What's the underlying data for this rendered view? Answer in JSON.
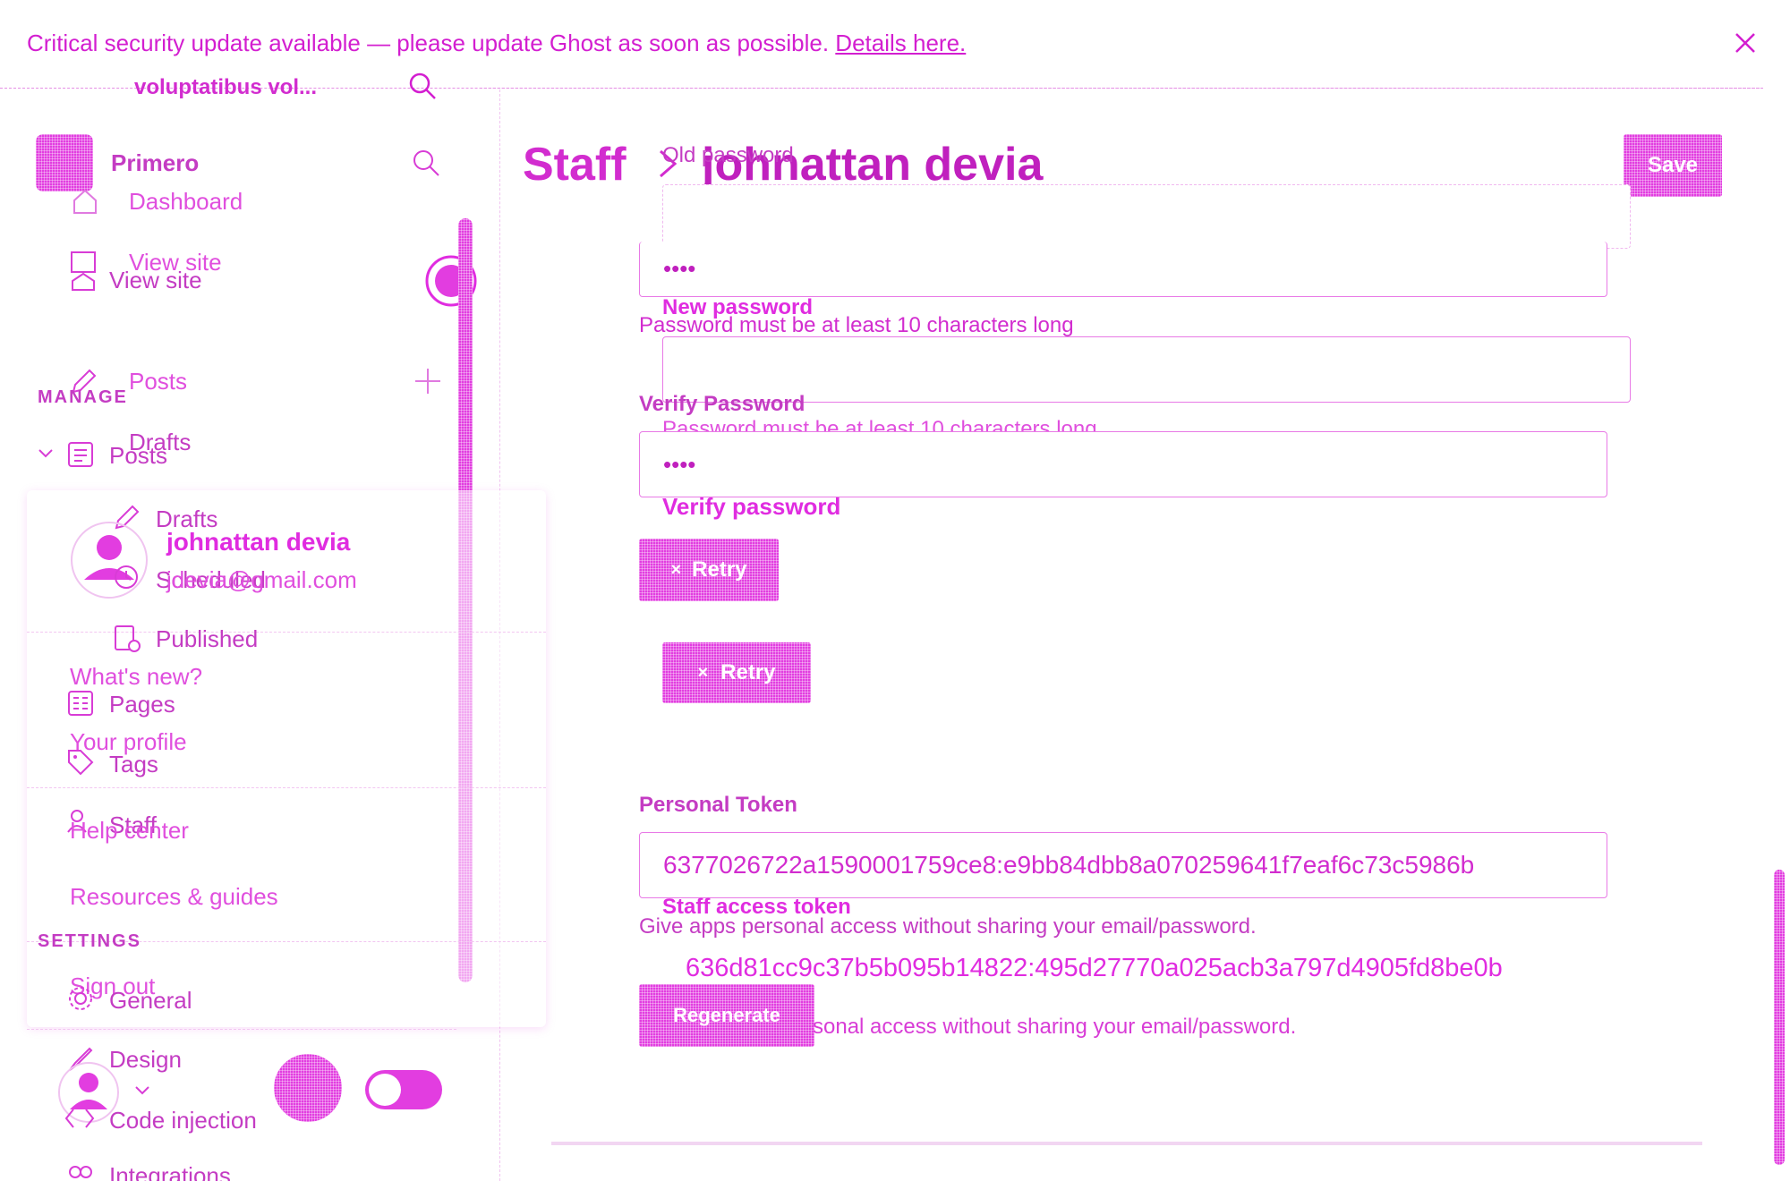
{
  "banner": {
    "message": "Critical security update available — please update Ghost as soon as possible.",
    "link": "Details here."
  },
  "topbar": {
    "site_name_truncated": "voluptatibus vol..."
  },
  "sidebar": {
    "site_name": "Primero",
    "items_top": [
      {
        "label": "Dashboard",
        "icon": "home-icon"
      },
      {
        "label": "View site",
        "icon": "view-site-icon"
      },
      {
        "label": "View site",
        "icon": "view-site-icon"
      }
    ],
    "manage_header": "MANAGE",
    "posts_label": "Posts",
    "posts_label_2": "Posts",
    "drafts_label": "Drafts",
    "drafts_label_2": "Drafts",
    "scheduled_label": "Scheduled",
    "published_label": "Published",
    "pages_label": "Pages",
    "tags_label": "Tags",
    "staff_label": "Staff",
    "settings_header": "SETTINGS",
    "general_label": "General",
    "design_label": "Design",
    "code_injection_label": "Code injection",
    "integrations_label": "Integrations"
  },
  "user_menu": {
    "name": "johnattan devia",
    "email": "jdevia@gmail.com",
    "whats_new": "What's new?",
    "your_profile": "Your profile",
    "help_center": "Help center",
    "resources": "Resources & guides",
    "sign_out": "Sign out"
  },
  "header": {
    "breadcrumb_root": "Staff",
    "breadcrumb_sep": ">",
    "title": "johnattan devia",
    "save_label": "Save"
  },
  "password": {
    "old_label": "Old password",
    "old_value": "••••",
    "error_1": "Password must be at least 10 characters long",
    "new_label": "New password",
    "verify_label": "Verify Password",
    "error_2": "Password must be at least 10 characters long.",
    "verify_value": "••••",
    "verify_label_2": "Verify password",
    "retry_label": "Retry",
    "retry_label_2": "Retry"
  },
  "token": {
    "header": "Personal Token",
    "value": "6377026722a1590001759ce8:e9bb84dbb8a070259641f7eaf6c73c5986b",
    "staff_label": "Staff access token",
    "help": "Give apps personal access without sharing your email/password.",
    "value_2": "636d81cc9c37b5b095b14822:495d27770a025acb3a797d4905fd8be0b",
    "help_2": "sonal access without sharing your email/password.",
    "regenerate_label": "Regenerate"
  },
  "colors": {
    "accent": "#e02ce0",
    "line": "#e58ee5"
  }
}
